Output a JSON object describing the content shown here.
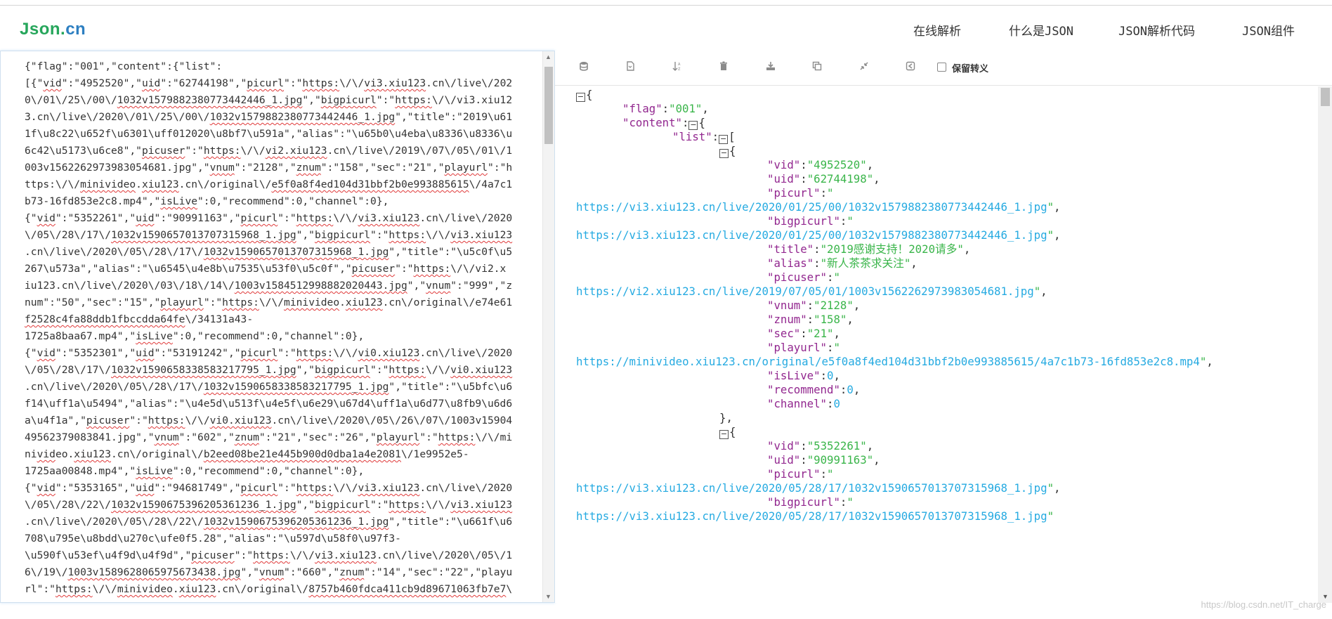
{
  "header": {
    "logo_main": "Json",
    "logo_dot": ".",
    "logo_cn": "cn",
    "nav": [
      {
        "label": "在线解析"
      },
      {
        "label": "什么是JSON"
      },
      {
        "label": "JSON解析代码"
      },
      {
        "label": "JSON组件"
      }
    ]
  },
  "toolbar": {
    "icons": [
      "database-icon",
      "file-icon",
      "sort-icon",
      "trash-icon",
      "download-icon",
      "copy-icon",
      "compress-icon",
      "share-icon"
    ],
    "checkbox_label": "保留转义",
    "checkbox_checked": false
  },
  "input_lines": [
    "{\"flag\":\"001\",\"content\":{\"list\":",
    "[{\"vid\":\"4952520\",\"uid\":\"62744198\",\"picurl\":\"https:\\/\\/vi3.xiu123.cn\\/live\\/202",
    "0\\/01\\/25\\/00\\/1032v1579882380773442446_1.jpg\",\"bigpicurl\":\"https:\\/\\/vi3.xiu12",
    "3.cn\\/live\\/2020\\/01\\/25\\/00\\/1032v1579882380773442446_1.jpg\",\"title\":\"2019\\u61",
    "1f\\u8c22\\u652f\\u6301\\uff012020\\u8bf7\\u591a\",\"alias\":\"\\u65b0\\u4eba\\u8336\\u8336\\u",
    "6c42\\u5173\\u6ce8\",\"picuser\":\"https:\\/\\/vi2.xiu123.cn\\/live\\/2019\\/07\\/05\\/01\\/1",
    "003v1562262973983054681.jpg\",\"vnum\":\"2128\",\"znum\":\"158\",\"sec\":\"21\",\"playurl\":\"h",
    "ttps:\\/\\/minivideo.xiu123.cn\\/original\\/e5f0a8f4ed104d31bbf2b0e993885615\\/4a7c1",
    "b73-16fd853e2c8.mp4\",\"isLive\":0,\"recommend\":0,\"channel\":0},",
    "{\"vid\":\"5352261\",\"uid\":\"90991163\",\"picurl\":\"https:\\/\\/vi3.xiu123.cn\\/live\\/2020",
    "\\/05\\/28\\/17\\/1032v1590657013707315968_1.jpg\",\"bigpicurl\":\"https:\\/\\/vi3.xiu123",
    ".cn\\/live\\/2020\\/05\\/28\\/17\\/1032v1590657013707315968_1.jpg\",\"title\":\"\\u5c0f\\u5",
    "267\\u573a\",\"alias\":\"\\u6545\\u4e8b\\u7535\\u53f0\\u5c0f\",\"picuser\":\"https:\\/\\/vi2.x",
    "iu123.cn\\/live\\/2020\\/03\\/18\\/14\\/1003v1584512998882020443.jpg\",\"vnum\":\"999\",\"z",
    "num\":\"50\",\"sec\":\"15\",\"playurl\":\"https:\\/\\/minivideo.xiu123.cn\\/original\\/e74e61",
    "f2528c4fa88ddb1fbccdda64fe\\/34131a43-",
    "1725a8baa67.mp4\",\"isLive\":0,\"recommend\":0,\"channel\":0},",
    "{\"vid\":\"5352301\",\"uid\":\"53191242\",\"picurl\":\"https:\\/\\/vi0.xiu123.cn\\/live\\/2020",
    "\\/05\\/28\\/17\\/1032v1590658338583217795_1.jpg\",\"bigpicurl\":\"https:\\/\\/vi0.xiu123",
    ".cn\\/live\\/2020\\/05\\/28\\/17\\/1032v1590658338583217795_1.jpg\",\"title\":\"\\u5bfc\\u6",
    "f14\\uff1a\\u5494\",\"alias\":\"\\u4e5d\\u513f\\u4e5f\\u6e29\\u67d4\\uff1a\\u6d77\\u8fb9\\u6d6",
    "a\\u4f1a\",\"picuser\":\"https:\\/\\/vi0.xiu123.cn\\/live\\/2020\\/05\\/26\\/07\\/1003v15904",
    "49562379083841.jpg\",\"vnum\":\"602\",\"znum\":\"21\",\"sec\":\"26\",\"playurl\":\"https:\\/\\/mi",
    "nivideo.xiu123.cn\\/original\\/b2eed08be21e445b900d0dba1a4e2081\\/1e9952e5-",
    "1725aa00848.mp4\",\"isLive\":0,\"recommend\":0,\"channel\":0},",
    "{\"vid\":\"5353165\",\"uid\":\"94681749\",\"picurl\":\"https:\\/\\/vi3.xiu123.cn\\/live\\/2020",
    "\\/05\\/28\\/22\\/1032v1590675396205361236_1.jpg\",\"bigpicurl\":\"https:\\/\\/vi3.xiu123",
    ".cn\\/live\\/2020\\/05\\/28\\/22\\/1032v1590675396205361236_1.jpg\",\"title\":\"\\u661f\\u6",
    "708\\u795e\\u8bdd\\u270c\\ufe0f5.28\",\"alias\":\"\\u597d\\u58f0\\u97f3-",
    "\\u590f\\u53ef\\u4f9d\\u4f9d\",\"picuser\":\"https:\\/\\/vi3.xiu123.cn\\/live\\/2020\\/05\\/1",
    "6\\/19\\/1003v1589628065975673438.jpg\",\"vnum\":\"660\",\"znum\":\"14\",\"sec\":\"22\",\"playu",
    "rl\":\"https:\\/\\/minivideo.xiu123.cn\\/original\\/8757b460fdca411cb9d89671063fb7e7\\"
  ],
  "parsed": {
    "flag_key": "\"flag\"",
    "flag_val": "\"001\"",
    "content_key": "\"content\"",
    "list_key": "\"list\"",
    "item1": {
      "vid": "\"4952520\"",
      "uid": "\"62744198\"",
      "picurl": "https://vi3.xiu123.cn/live/2020/01/25/00/1032v1579882380773442446_1.jpg",
      "bigpicurl": "https://vi3.xiu123.cn/live/2020/01/25/00/1032v1579882380773442446_1.jpg",
      "title": "\"2019感谢支持！2020请多\"",
      "alias": "\"新人茶茶求关注\"",
      "picuser": "https://vi2.xiu123.cn/live/2019/07/05/01/1003v1562262973983054681.jpg",
      "vnum": "\"2128\"",
      "znum": "\"158\"",
      "sec": "\"21\"",
      "playurl": "https://minivideo.xiu123.cn/original/e5f0a8f4ed104d31bbf2b0e993885615/4a7c1b73-16fd853e2c8.mp4",
      "isLive": "0",
      "recommend": "0",
      "channel": "0"
    },
    "item2": {
      "vid": "\"5352261\"",
      "uid": "\"90991163\"",
      "picurl": "https://vi3.xiu123.cn/live/2020/05/28/17/1032v1590657013707315968_1.jpg",
      "bigpicurl": "https://vi3.xiu123.cn/live/2020/05/28/17/1032v1590657013707315968_1.jpg"
    }
  },
  "watermark": "https://blog.csdn.net/IT_charge"
}
